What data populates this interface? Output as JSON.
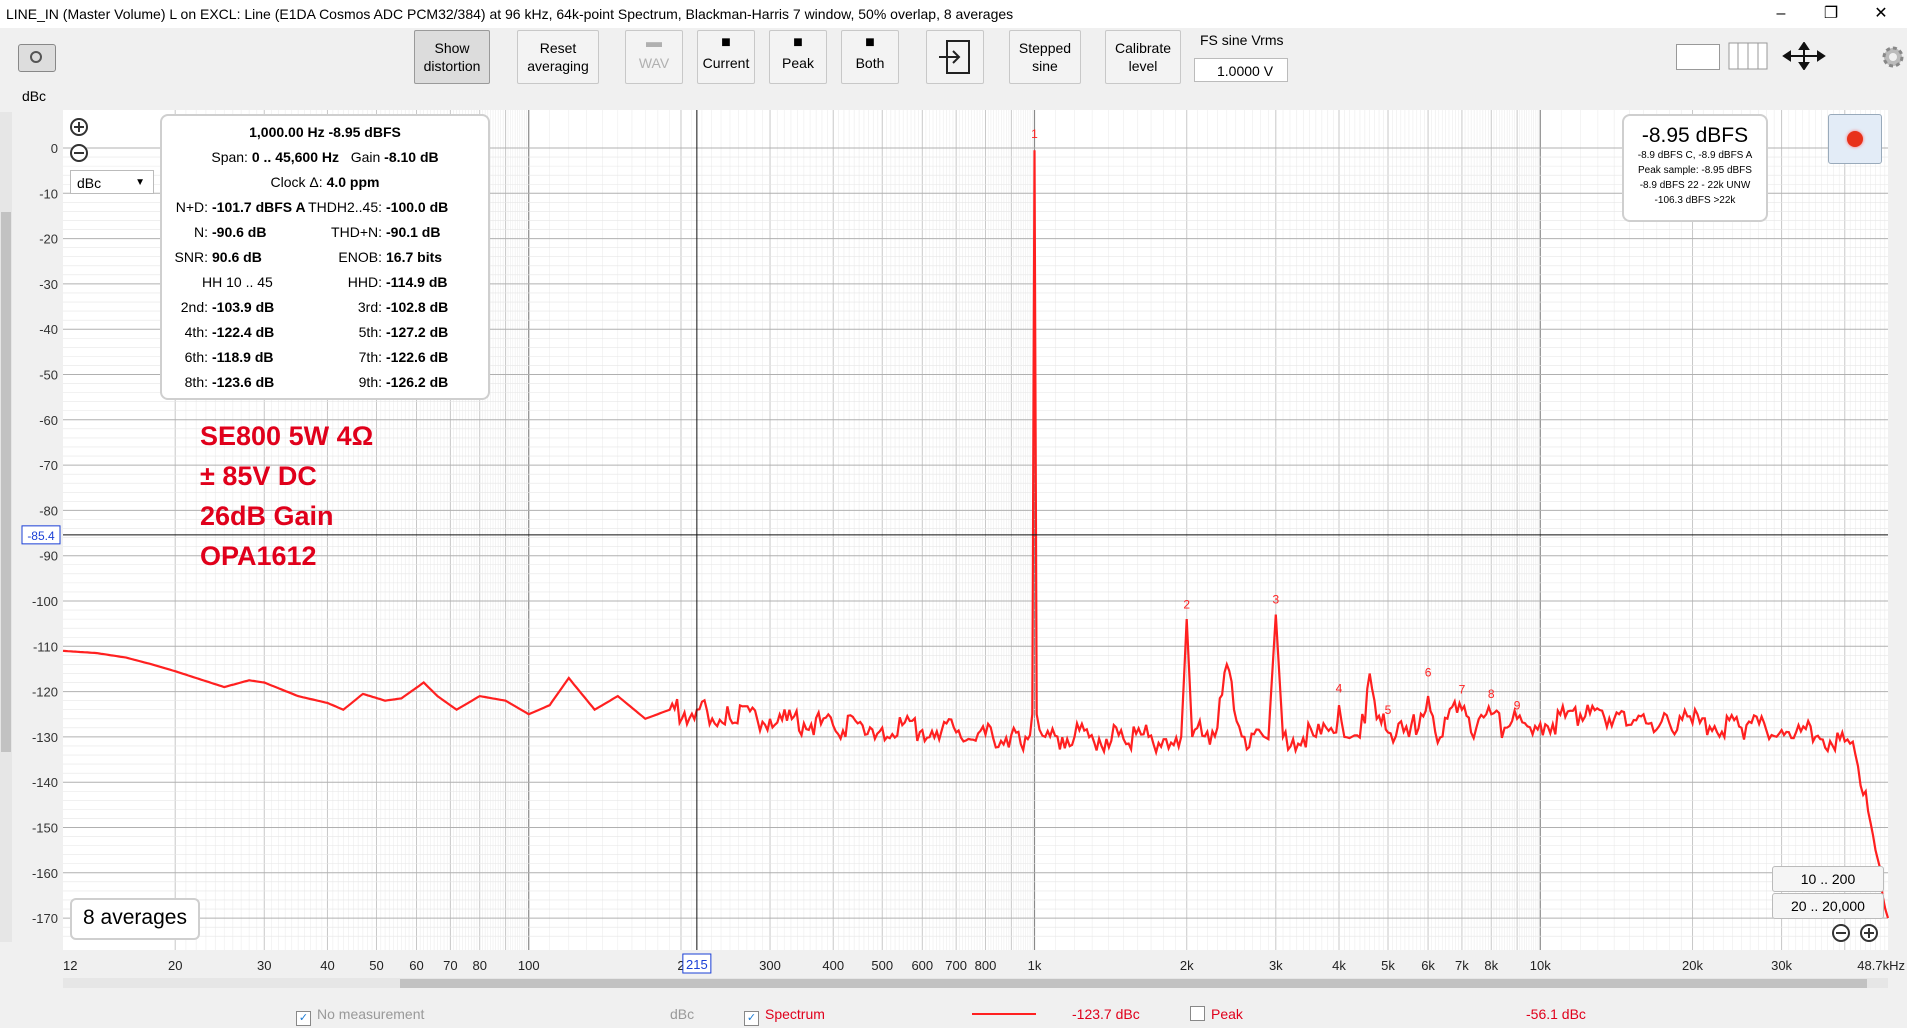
{
  "window": {
    "title": "LINE_IN (Master Volume) L on EXCL: Line (E1DA Cosmos ADC PCM32/384) at 96 kHz, 64k-point Spectrum, Blackman-Harris 7 window, 50% overlap, 8 averages",
    "minimize": "–",
    "restore": "❐",
    "close": "✕"
  },
  "toolbar": {
    "show_distortion": "Show\ndistortion",
    "reset_averaging": "Reset\naveraging",
    "wav": "WAV",
    "current": "Current",
    "peak": "Peak",
    "both": "Both",
    "stepped_sine": "Stepped\nsine",
    "calibrate_level": "Calibrate\nlevel",
    "fs_label": "FS sine Vrms",
    "fs_value": "1.0000 V"
  },
  "stats": {
    "line1": "1,000.00 Hz  -8.95 dBFS",
    "span_label": "Span:",
    "span_value": "0 .. 45,600 Hz",
    "gain_label": "Gain",
    "gain_value": "-8.10 dB",
    "clock_label": "Clock Δ:",
    "clock_value": "4.0 ppm",
    "nd_label": "N+D:",
    "nd_value": "-101.7 dBFS A",
    "thd_label": "THDH2..45:",
    "thd_value": "-100.0 dB",
    "n_label": "N:",
    "n_value": "-90.6 dB",
    "thdn_label": "THD+N:",
    "thdn_value": "-90.1 dB",
    "snr_label": "SNR:",
    "snr_value": "90.6 dB",
    "enob_label": "ENOB:",
    "enob_value": "16.7 bits",
    "hh_label": "HH 10 .. 45",
    "hhd_label": "HHD:",
    "hhd_value": "-114.9 dB",
    "h2_label": "2nd:",
    "h2_value": "-103.9 dB",
    "h3_label": "3rd:",
    "h3_value": "-102.8 dB",
    "h4_label": "4th:",
    "h4_value": "-122.4 dB",
    "h5_label": "5th:",
    "h5_value": "-127.2 dB",
    "h6_label": "6th:",
    "h6_value": "-118.9 dB",
    "h7_label": "7th:",
    "h7_value": "-122.6 dB",
    "h8_label": "8th:",
    "h8_value": "-123.6 dB",
    "h9_label": "9th:",
    "h9_value": "-126.2 dB"
  },
  "level_meter": {
    "main": "-8.95 dBFS",
    "line1": "-8.9 dBFS C, -8.9 dBFS A",
    "line2": "Peak sample: -8.95 dBFS",
    "line3": "-8.9 dBFS 22 - 22k UNW",
    "line4": "-106.3 dBFS >22k"
  },
  "annotation": {
    "line1": "SE800 5W 4Ω",
    "line2": "± 85V DC",
    "line3": "26dB Gain",
    "line4": "OPA1612"
  },
  "units_selector": "dBc",
  "y_unit": "dBc",
  "averages_badge": "8 averages",
  "cursor": {
    "y_readout": "-85.4",
    "x_readout": "215"
  },
  "range_buttons": {
    "r1": "10 .. 200",
    "r2": "20 .. 20,000"
  },
  "legend": {
    "no_measurement": "No measurement",
    "no_measurement_unit": "dBc",
    "spectrum": "Spectrum",
    "spectrum_value": "-123.7 dBc",
    "peak": "Peak",
    "peak_value": "-56.1 dBc"
  },
  "colors": {
    "trace": "#ff2020",
    "annotation": "#e0001b",
    "cursor_box": "#1a3fd6"
  },
  "chart_data": {
    "type": "line",
    "xscale": "log",
    "xlim": [
      12,
      48700
    ],
    "ylim": [
      -175,
      5
    ],
    "ylabel": "dBc",
    "grid": true,
    "y_ticks": [
      0,
      -10,
      -20,
      -30,
      -40,
      -50,
      -60,
      -70,
      -80,
      -90,
      -100,
      -110,
      -120,
      -130,
      -140,
      -150,
      -160,
      -170
    ],
    "x_ticks": [
      {
        "v": 12,
        "l": "12"
      },
      {
        "v": 20,
        "l": "20"
      },
      {
        "v": 30,
        "l": "30"
      },
      {
        "v": 40,
        "l": "40"
      },
      {
        "v": 50,
        "l": "50"
      },
      {
        "v": 60,
        "l": "60"
      },
      {
        "v": 70,
        "l": "70"
      },
      {
        "v": 80,
        "l": "80"
      },
      {
        "v": 100,
        "l": "100"
      },
      {
        "v": 200,
        "l": "2"
      },
      {
        "v": 300,
        "l": "300"
      },
      {
        "v": 400,
        "l": "400"
      },
      {
        "v": 500,
        "l": "500"
      },
      {
        "v": 600,
        "l": "600"
      },
      {
        "v": 700,
        "l": "700"
      },
      {
        "v": 800,
        "l": "800"
      },
      {
        "v": 1000,
        "l": "1k"
      },
      {
        "v": 2000,
        "l": "2k"
      },
      {
        "v": 3000,
        "l": "3k"
      },
      {
        "v": 4000,
        "l": "4k"
      },
      {
        "v": 5000,
        "l": "5k"
      },
      {
        "v": 6000,
        "l": "6k"
      },
      {
        "v": 7000,
        "l": "7k"
      },
      {
        "v": 8000,
        "l": "8k"
      },
      {
        "v": 10000,
        "l": "10k"
      },
      {
        "v": 20000,
        "l": "20k"
      },
      {
        "v": 30000,
        "l": "30k"
      },
      {
        "v": 48700,
        "l": "48.7kHz"
      }
    ],
    "series": [
      {
        "name": "Spectrum",
        "points": [
          [
            12,
            -111
          ],
          [
            14,
            -111.5
          ],
          [
            16,
            -112.5
          ],
          [
            18,
            -114
          ],
          [
            20,
            -115.5
          ],
          [
            22,
            -117
          ],
          [
            25,
            -119
          ],
          [
            28,
            -117.5
          ],
          [
            30,
            -118
          ],
          [
            35,
            -121
          ],
          [
            40,
            -122.5
          ],
          [
            43,
            -124
          ],
          [
            47,
            -120.5
          ],
          [
            52,
            -122
          ],
          [
            56,
            -121.5
          ],
          [
            62,
            -118
          ],
          [
            66,
            -121
          ],
          [
            72,
            -124
          ],
          [
            80,
            -121
          ],
          [
            90,
            -122
          ],
          [
            100,
            -125
          ],
          [
            110,
            -123
          ],
          [
            120,
            -117
          ],
          [
            135,
            -124
          ],
          [
            150,
            -121
          ],
          [
            170,
            -126
          ],
          [
            190,
            -124
          ],
          [
            215,
            -124
          ],
          [
            250,
            -126
          ],
          [
            300,
            -126
          ],
          [
            350,
            -127
          ],
          [
            400,
            -127.5
          ],
          [
            500,
            -128
          ],
          [
            600,
            -128.5
          ],
          [
            700,
            -129
          ],
          [
            800,
            -129.5
          ],
          [
            900,
            -129.5
          ],
          [
            960,
            -130
          ],
          [
            990,
            -125
          ],
          [
            1000,
            -0.5
          ],
          [
            1010,
            -125
          ],
          [
            1050,
            -130
          ],
          [
            1200,
            -130
          ],
          [
            1500,
            -130.5
          ],
          [
            1800,
            -130.5
          ],
          [
            1950,
            -130
          ],
          [
            2000,
            -104
          ],
          [
            2050,
            -130
          ],
          [
            2300,
            -128
          ],
          [
            2400,
            -114
          ],
          [
            2480,
            -124
          ],
          [
            2600,
            -130
          ],
          [
            2900,
            -130.5
          ],
          [
            3000,
            -103
          ],
          [
            3100,
            -130
          ],
          [
            3600,
            -130
          ],
          [
            3950,
            -129
          ],
          [
            4000,
            -123
          ],
          [
            4100,
            -130
          ],
          [
            4500,
            -127
          ],
          [
            4600,
            -116
          ],
          [
            4750,
            -126
          ],
          [
            5000,
            -129
          ],
          [
            5500,
            -130
          ],
          [
            6000,
            -121
          ],
          [
            6200,
            -129
          ],
          [
            7000,
            -124
          ],
          [
            7300,
            -129
          ],
          [
            8000,
            -125
          ],
          [
            8500,
            -128
          ],
          [
            9000,
            -126
          ],
          [
            10000,
            -127
          ],
          [
            12000,
            -125
          ],
          [
            14000,
            -126
          ],
          [
            16000,
            -125
          ],
          [
            18000,
            -127
          ],
          [
            20000,
            -127
          ],
          [
            25000,
            -128
          ],
          [
            30000,
            -128.5
          ],
          [
            35000,
            -130
          ],
          [
            40000,
            -131
          ],
          [
            42000,
            -134
          ],
          [
            44000,
            -142
          ],
          [
            46000,
            -155
          ],
          [
            47500,
            -165
          ],
          [
            48700,
            -170
          ]
        ]
      }
    ],
    "harmonic_markers": [
      {
        "label": "1",
        "f": 1000,
        "db": 0
      },
      {
        "label": "2",
        "f": 2000,
        "db": -103.9
      },
      {
        "label": "3",
        "f": 3000,
        "db": -102.8
      },
      {
        "label": "4",
        "f": 4000,
        "db": -122.4
      },
      {
        "label": "5",
        "f": 5000,
        "db": -127.2
      },
      {
        "label": "6",
        "f": 6000,
        "db": -118.9
      },
      {
        "label": "7",
        "f": 7000,
        "db": -122.6
      },
      {
        "label": "8",
        "f": 8000,
        "db": -123.6
      },
      {
        "label": "9",
        "f": 9000,
        "db": -126.2
      }
    ]
  }
}
